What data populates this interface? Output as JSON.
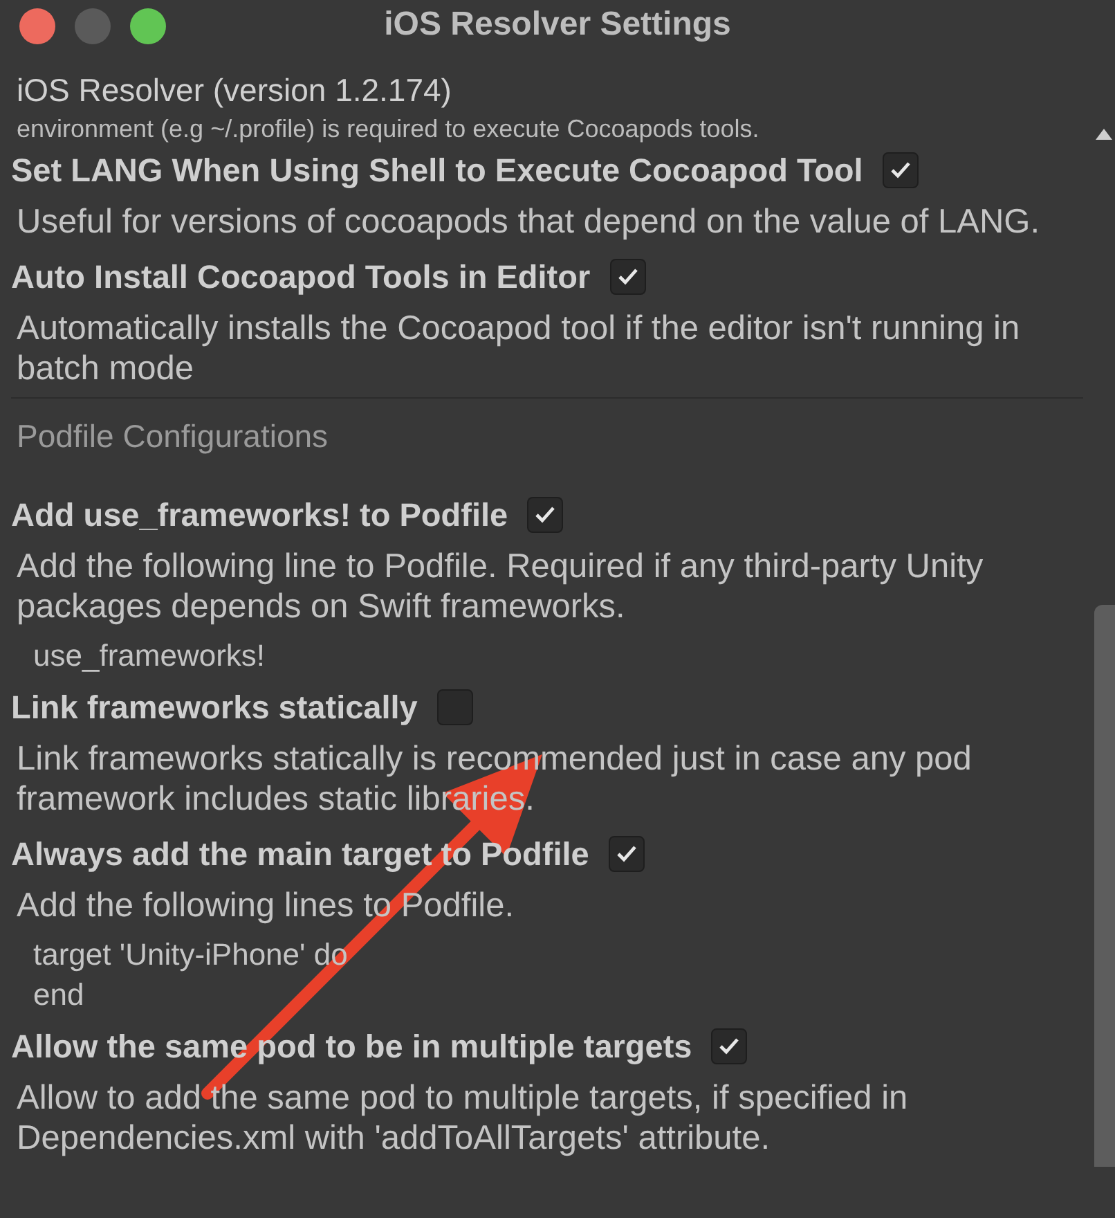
{
  "window": {
    "title": "iOS Resolver Settings"
  },
  "header": "iOS Resolver (version 1.2.174)",
  "items": [
    {
      "kind": "description",
      "text": "environment (e.g ~/.profile) is required to execute Cocoapods tools."
    },
    {
      "kind": "toggle",
      "label": "Set LANG When Using Shell to Execute Cocoapod Tool",
      "checked": true
    },
    {
      "kind": "description",
      "text": "Useful for versions of cocoapods that depend on the value of LANG."
    },
    {
      "kind": "toggle",
      "label": "Auto Install Cocoapod Tools in Editor",
      "checked": true
    },
    {
      "kind": "description",
      "text": "Automatically installs the Cocoapod tool if the editor isn't running in batch mode"
    },
    {
      "kind": "section",
      "text": "Podfile Configurations"
    },
    {
      "kind": "toggle",
      "label": "Add use_frameworks! to Podfile",
      "checked": true
    },
    {
      "kind": "description",
      "text": "Add the following line to Podfile. Required if any third-party Unity packages depends on Swift frameworks."
    },
    {
      "kind": "code",
      "lines": [
        "use_frameworks!"
      ]
    },
    {
      "kind": "toggle",
      "label": "Link frameworks statically",
      "checked": false
    },
    {
      "kind": "description",
      "text": "Link frameworks statically is recommended just in case any pod framework includes static libraries."
    },
    {
      "kind": "toggle",
      "label": "Always add the main target to Podfile",
      "checked": true
    },
    {
      "kind": "description",
      "text": "Add the following lines to Podfile."
    },
    {
      "kind": "code",
      "lines": [
        "target 'Unity-iPhone' do",
        "end"
      ]
    },
    {
      "kind": "toggle",
      "label": "Allow the same pod to be in multiple targets",
      "checked": true
    },
    {
      "kind": "description",
      "text": "Allow to add the same pod to multiple targets, if specified in Dependencies.xml with 'addToAllTargets' attribute."
    }
  ]
}
